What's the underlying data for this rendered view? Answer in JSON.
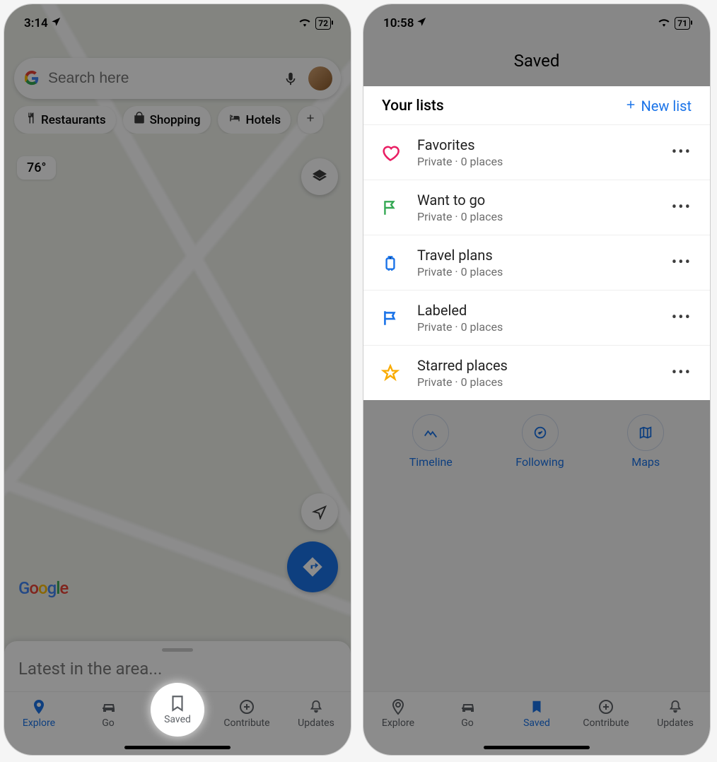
{
  "left": {
    "status": {
      "time": "3:14",
      "battery": "72"
    },
    "search": {
      "placeholder": "Search here"
    },
    "chips": {
      "restaurants": "Restaurants",
      "shopping": "Shopping",
      "hotels": "Hotels"
    },
    "temperature": "76°",
    "logo": "Google",
    "sheet_title": "Latest in the area...",
    "nav": {
      "explore": "Explore",
      "go": "Go",
      "saved": "Saved",
      "contribute": "Contribute",
      "updates": "Updates"
    }
  },
  "right": {
    "status": {
      "time": "10:58",
      "battery": "71"
    },
    "header_title": "Saved",
    "your_lists_label": "Your lists",
    "new_list_label": "New list",
    "lists": [
      {
        "name": "Favorites",
        "sub": "Private · 0 places",
        "icon": "heart",
        "color": "#e91e63"
      },
      {
        "name": "Want to go",
        "sub": "Private · 0 places",
        "icon": "flag",
        "color": "#34a853"
      },
      {
        "name": "Travel plans",
        "sub": "Private · 0 places",
        "icon": "suitcase",
        "color": "#1a73e8"
      },
      {
        "name": "Labeled",
        "sub": "Private · 0 places",
        "icon": "label-flag",
        "color": "#1a73e8"
      },
      {
        "name": "Starred places",
        "sub": "Private · 0 places",
        "icon": "star",
        "color": "#f9ab00"
      }
    ],
    "tabs": {
      "timeline": "Timeline",
      "following": "Following",
      "maps": "Maps"
    },
    "nav": {
      "explore": "Explore",
      "go": "Go",
      "saved": "Saved",
      "contribute": "Contribute",
      "updates": "Updates"
    }
  }
}
